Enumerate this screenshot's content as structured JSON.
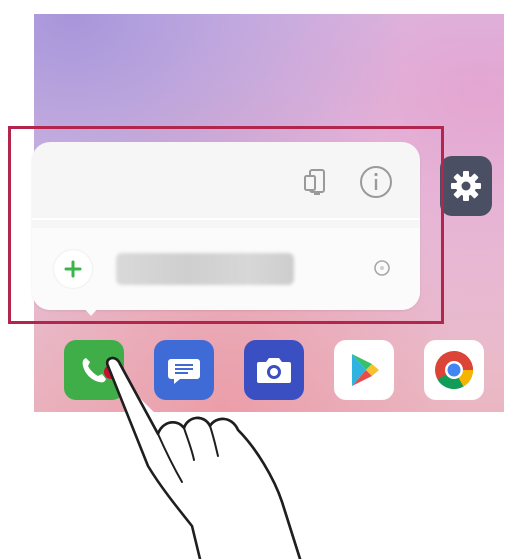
{
  "screen": {
    "description_label": "",
    "colors": {
      "highlight_frame": "#b2264e",
      "settings_icon_bg": "#4b4f63",
      "phone_app_bg": "#3fae49",
      "messages_app_bg": "#3e6bd6",
      "camera_app_bg": "#3a4fc2",
      "add_plus": "#39b54a"
    }
  },
  "popup": {
    "top_icons": [
      "widget-icon",
      "info-icon"
    ],
    "shortcut": {
      "add_icon": "plus-icon",
      "label": "",
      "trailing_icon": "ring-icon"
    }
  },
  "dock": {
    "apps": [
      {
        "name": "phone",
        "icon": "phone-icon"
      },
      {
        "name": "messages",
        "icon": "message-icon"
      },
      {
        "name": "camera",
        "icon": "camera-icon"
      },
      {
        "name": "play-store",
        "icon": "play-store-icon"
      },
      {
        "name": "chrome",
        "icon": "chrome-icon"
      }
    ]
  },
  "gesture": {
    "icon": "tap-hand-icon",
    "action": "touch and hold"
  }
}
